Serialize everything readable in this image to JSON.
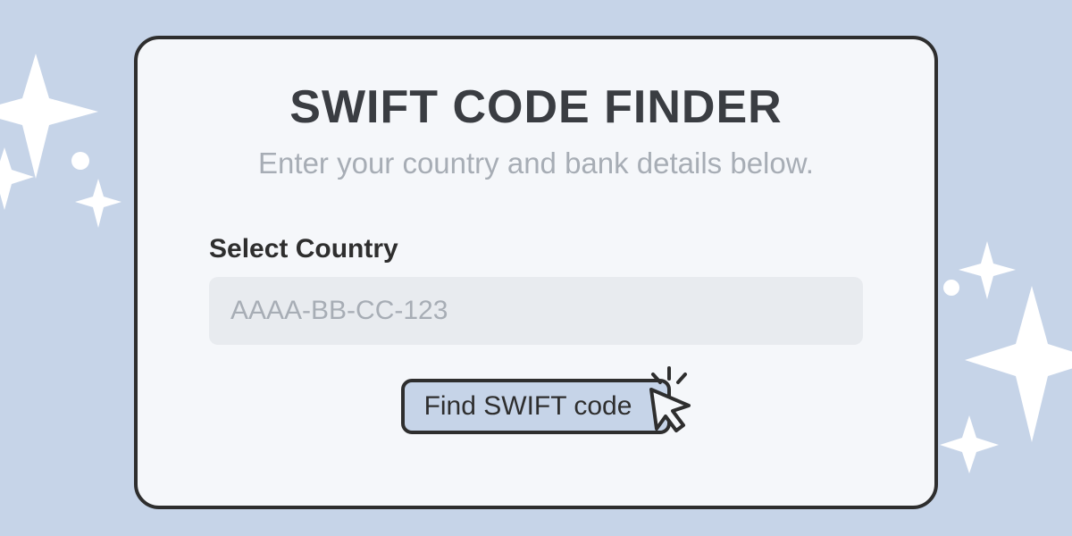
{
  "card": {
    "title": "SWIFT CODE FINDER",
    "subtitle": "Enter your country and bank details below.",
    "field_label": "Select Country",
    "input_placeholder": "AAAA-BB-CC-123",
    "button_label": "Find SWIFT code"
  },
  "colors": {
    "background": "#c6d4e8",
    "card_bg": "#f5f7fa",
    "border": "#2e2e2e",
    "title_text": "#3a3d42",
    "muted_text": "#a7adb5",
    "input_bg": "#e8ebef",
    "sparkle": "#ffffff"
  }
}
